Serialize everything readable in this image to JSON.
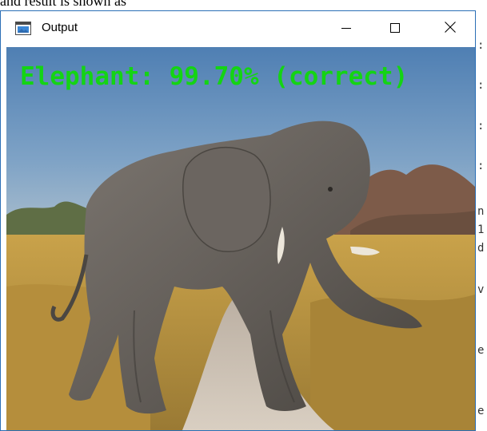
{
  "background_text": {
    "top_line": "and result is shown as",
    "right_edge_chars": [
      ":",
      ":",
      ":",
      ":",
      "n",
      "1",
      "d",
      "v",
      "e",
      "e"
    ]
  },
  "window": {
    "title": "Output",
    "icons": {
      "app": "image-window-icon",
      "minimize": "minimize-icon",
      "maximize": "maximize-icon",
      "close": "close-icon"
    }
  },
  "image": {
    "subject": "elephant-photo",
    "overlay_text": "Elephant: 99.70% (correct)",
    "overlay_color": "#14d414"
  }
}
